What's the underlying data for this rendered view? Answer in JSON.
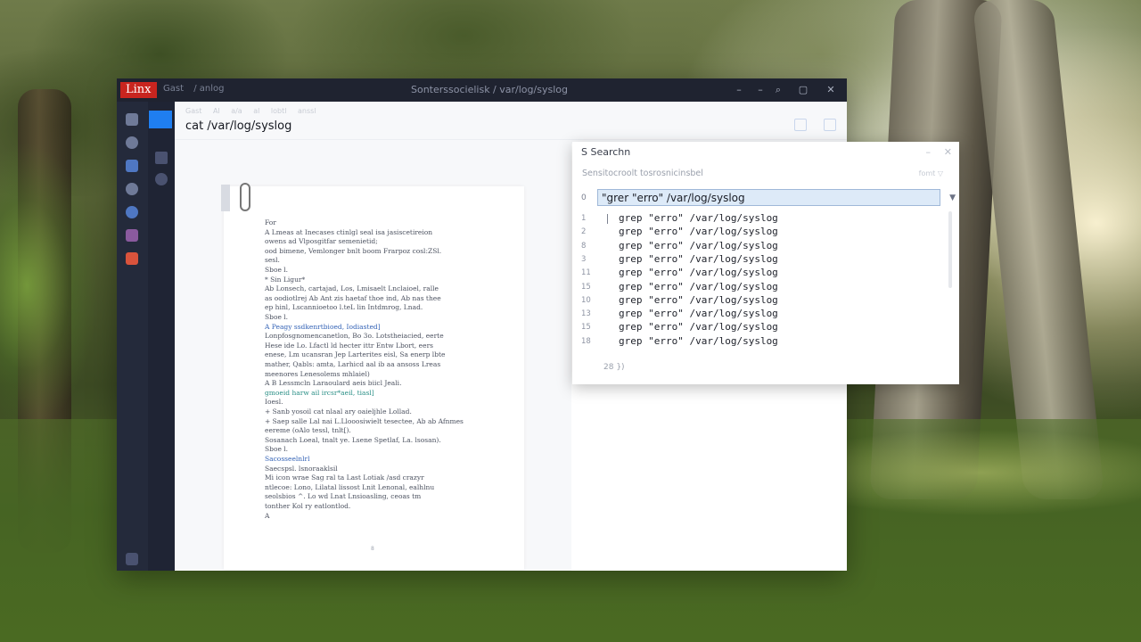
{
  "window": {
    "app_badge": "Linx",
    "menu": [
      "Gast",
      "/ anlog"
    ],
    "title": "Sonterssocielisk / var/log/syslog",
    "controls": {
      "minimize": "–",
      "search": "⌕",
      "maximize": "▢",
      "close": "✕"
    }
  },
  "content": {
    "breadcrumbs": [
      "Gast",
      "Al",
      "a/a",
      "al",
      "lobtl",
      "anssl"
    ],
    "heading": "cat /var/log/syslog"
  },
  "document": {
    "lines": [
      "For",
      "A  Lmeas at Inecases ctinlgl seal isa jasiscetireion",
      "   owens ad Vlposgitfar semenietid;",
      "   ood bimene, Vemlonger bnlt boom Frarpoz cosl:ZSl.",
      "   sesl.",
      "   Sboe l.",
      "  * Sin Ligur*",
      "   Ab Lonsech, cartajad, Los, Lmisaelt Lnclaioel, ralle",
      "   as oodiotlrej Ab Ant zis haetaf thoe ind, Ab nas thee",
      "   ep hinl, Lscannioetoo  l.teL lin Intdmrog, Lnad.",
      "   Sboe l.",
      "A  Peagy ssdkenrtbioed, Iodiasted]",
      "   Lonpfosgnomencanetlon, Bo 3o. Lotstheiacied, eerte",
      "   Hese ide Lo. Lfactl ld hecter ittr Entw Lbort, eers",
      "   enese, Lm ucansran Jep Larterites eisl, Sa enerp lbte",
      "   mather, Qabls: amta, Larhicd aal ib  aa ansoss Lreas",
      "   meenores  Lenesolems mhlaiel)",
      "A  B Lessmcln Laraoulard  aeis biicl Jeali.",
      "gmoeid harw  ail ircsr*aeil, tiasl]",
      "  Ioesl.",
      "   +  Sanb yosoil  cat nlaal ary oaieljhle Lollad.",
      "   + Saep salle Lal nai L.Llooosiwielt tesectee, Ab ab Afnmes",
      "     eereme (oAlo tessl, tnlt[).",
      "     Sosanach Loeal, tnalt ye. Lsene Spetlaf, La. lsosan).",
      "  Sboe l.",
      "     Sacosseelnlrl",
      "     Saecspsl. lsnoraaklsil",
      "     Mi icon wrae Sag ral ta Last Lotiak /asd crazyr",
      "     ntlecoe: Lono, Lilatal lissost Lnit Lenonal, ealhlnu",
      "     seolsbios ^. Lo wd  Lnat Lnsioasling, ceoas tm",
      "     tonther Kol ry eatlontlod.",
      "A"
    ],
    "page_marker": "8"
  },
  "search": {
    "title": "S  Searchn",
    "subtitle": "Sensitocroolt tosrosnicinsbel",
    "badge": "fomt ▽",
    "input_row_num": "0",
    "query": "\"grer \"erro\" /var/log/syslog",
    "result_numbers": [
      "1",
      "2",
      "8",
      "3",
      "11",
      "15",
      "10",
      "13",
      "15",
      "18"
    ],
    "result_text": "grep \"erro\" /var/log/syslog",
    "end_marker": "28  })"
  }
}
